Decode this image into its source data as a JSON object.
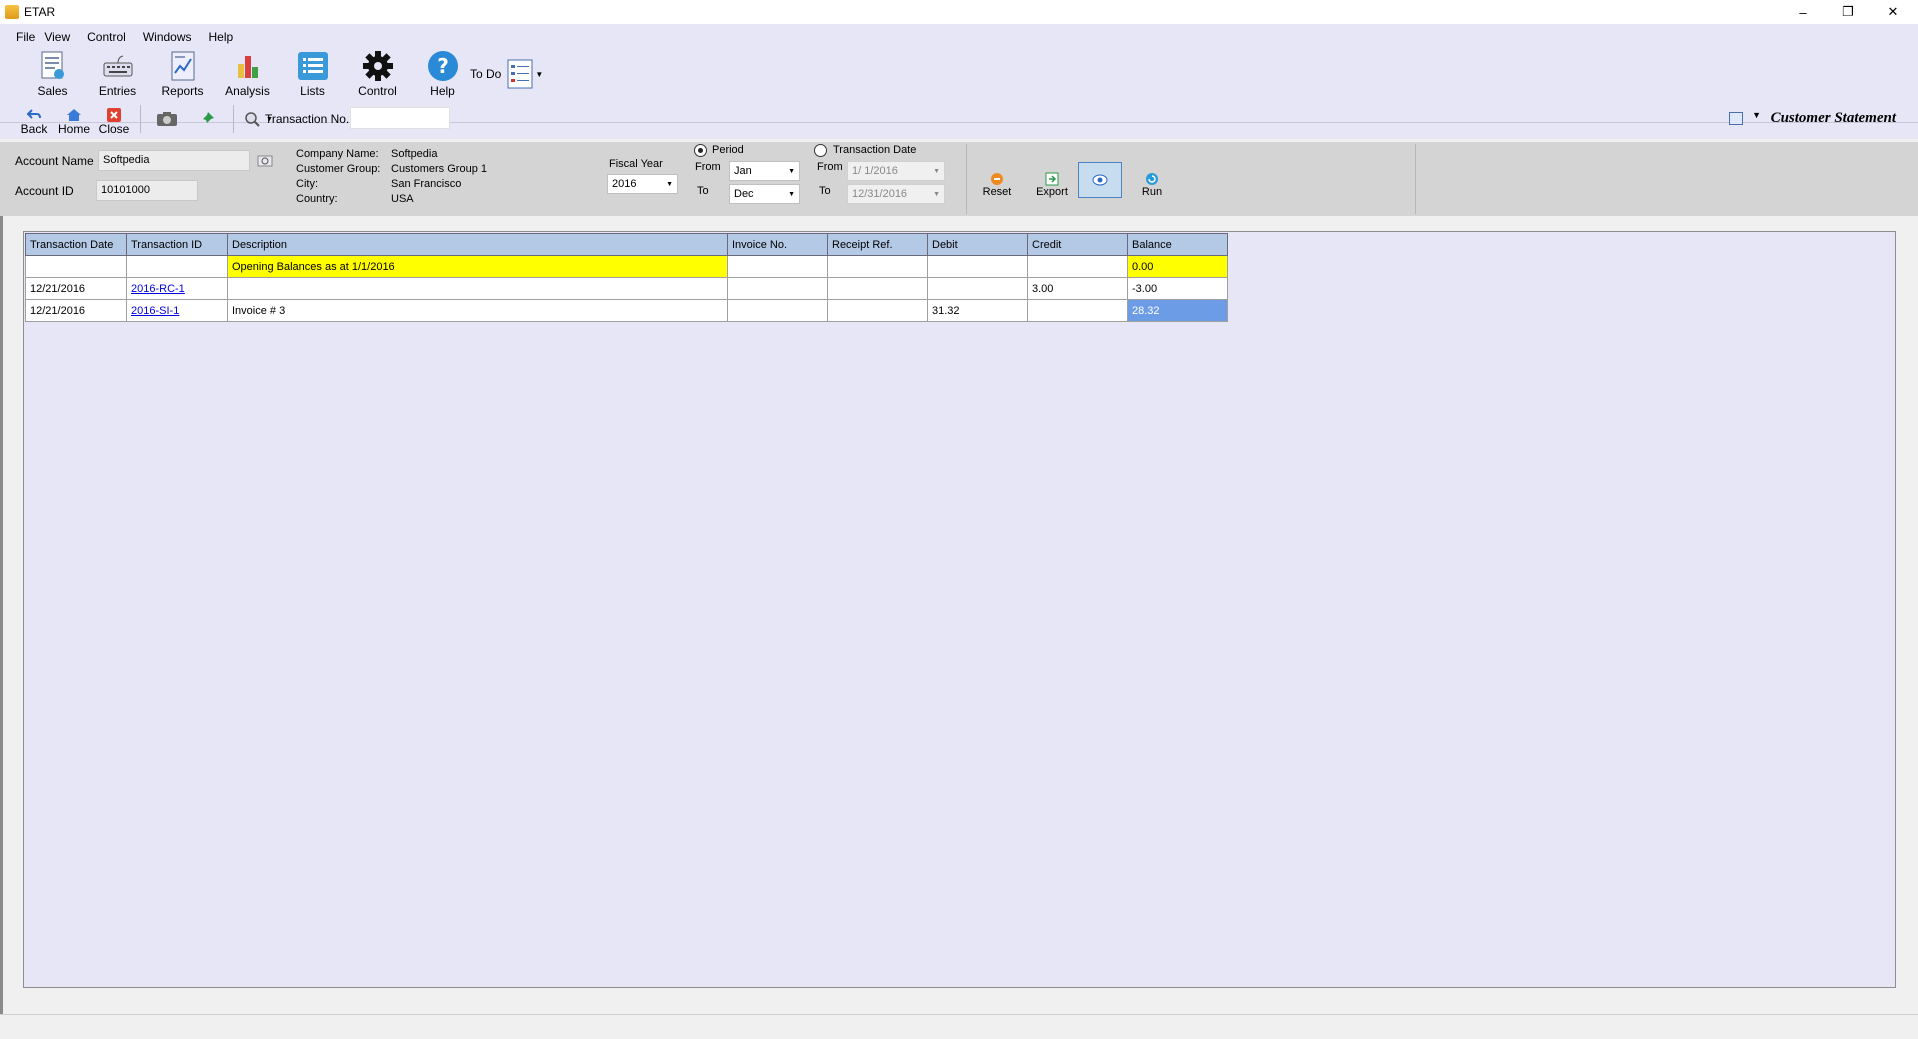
{
  "window": {
    "title": "ETAR",
    "controls": [
      "–",
      "❐",
      "✕"
    ]
  },
  "menu": [
    "File",
    "View",
    "Control",
    "Windows",
    "Help"
  ],
  "main_toolbar": [
    {
      "label": "Sales",
      "icon": "sales-icon"
    },
    {
      "label": "Entries",
      "icon": "keyboard-icon"
    },
    {
      "label": "Reports",
      "icon": "reports-icon"
    },
    {
      "label": "Analysis",
      "icon": "analysis-icon"
    },
    {
      "label": "Lists",
      "icon": "lists-icon"
    },
    {
      "label": "Control",
      "icon": "gear-icon"
    },
    {
      "label": "Help",
      "icon": "help-icon"
    }
  ],
  "todo": {
    "label": "To Do"
  },
  "nav_toolbar": {
    "back": "Back",
    "home": "Home",
    "close": "Close"
  },
  "transaction_no": {
    "label": "Transaction No.",
    "value": ""
  },
  "page_title": "Customer Statement",
  "account": {
    "name_label": "Account Name",
    "name": "Softpedia",
    "id_label": "Account ID",
    "id": "10101000"
  },
  "company": {
    "company_label": "Company Name:",
    "company": "Softpedia",
    "group_label": "Customer Group:",
    "group": "Customers Group 1",
    "city_label": "City:",
    "city": "San Francisco",
    "country_label": "Country:",
    "country": "USA"
  },
  "fiscal": {
    "label": "Fiscal Year",
    "value": "2016"
  },
  "period": {
    "label": "Period",
    "selected": true,
    "from_label": "From",
    "from": "Jan",
    "to_label": "To",
    "to": "Dec"
  },
  "txn_date": {
    "label": "Transaction Date",
    "selected": false,
    "from_label": "From",
    "from": "1/  1/2016",
    "to_label": "To",
    "to": "12/31/2016"
  },
  "actions": {
    "reset": "Reset",
    "export": "Export",
    "run": "Run"
  },
  "grid": {
    "columns": [
      "Transaction Date",
      "Transaction ID",
      "Description",
      "Invoice No.",
      "Receipt Ref.",
      "Debit",
      "Credit",
      "Balance"
    ],
    "rows": [
      [
        "",
        "",
        "Opening Balances as at 1/1/2016",
        "",
        "",
        "",
        "",
        "0.00"
      ],
      [
        "12/21/2016",
        "2016-RC-1",
        "",
        "",
        "",
        "",
        "3.00",
        "-3.00"
      ],
      [
        "12/21/2016",
        "2016-SI-1",
        "Invoice # 3",
        "",
        "",
        "31.32",
        "",
        "28.32"
      ]
    ]
  },
  "colors": {
    "ribbon": "#e6e6f7",
    "header": "#b4c9e6",
    "highlight": "#ffff00",
    "selection": "#6c9ce6"
  }
}
